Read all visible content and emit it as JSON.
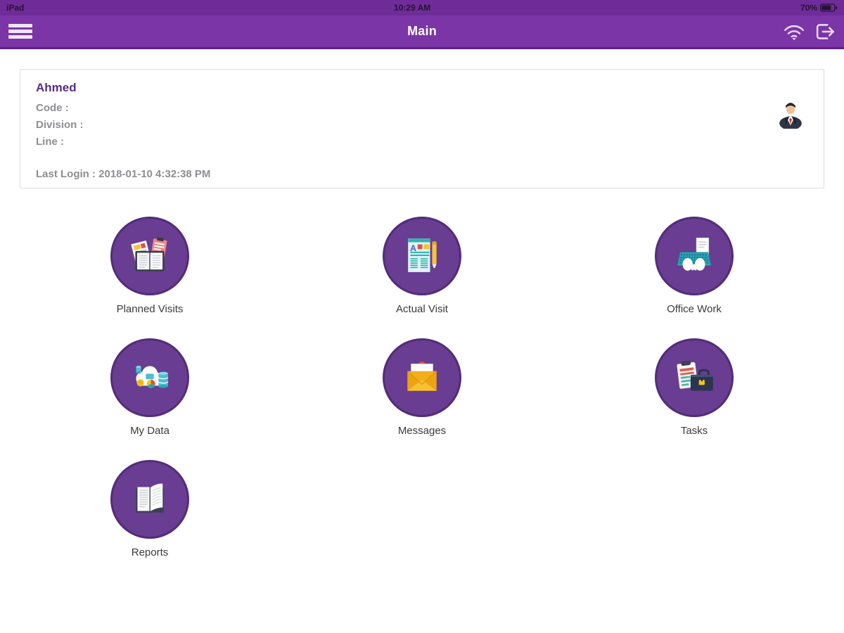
{
  "status_bar": {
    "device": "iPad",
    "time": "10:29 AM",
    "battery_percent": "70%"
  },
  "nav_bar": {
    "title": "Main",
    "icons": [
      "menu-icon",
      "wifi-icon",
      "logout-icon"
    ]
  },
  "user_card": {
    "name": "Ahmed",
    "code_label": "Code :",
    "division_label": "Division :",
    "line_label": "Line :",
    "last_login": "Last Login : 2018-01-10 4:32:38 PM",
    "avatar": "businessman-avatar"
  },
  "menu": {
    "items": [
      {
        "label": "Planned Visits",
        "icon": "planned-visits-icon"
      },
      {
        "label": "Actual Visit",
        "icon": "actual-visit-icon"
      },
      {
        "label": "Office Work",
        "icon": "office-work-icon"
      },
      {
        "label": "My Data",
        "icon": "my-data-icon"
      },
      {
        "label": "Messages",
        "icon": "messages-icon"
      },
      {
        "label": "Tasks",
        "icon": "tasks-icon"
      },
      {
        "label": "Reports",
        "icon": "reports-icon"
      }
    ]
  },
  "colors": {
    "status_bar_purple": "#6f2c99",
    "nav_bar_purple": "#7b35a7",
    "tile_purple": "#693d92",
    "tile_ring_purple": "#532d78",
    "name_purple": "#5b2c83",
    "muted_text": "#8e8e93",
    "label_text": "#3b3b3b"
  }
}
